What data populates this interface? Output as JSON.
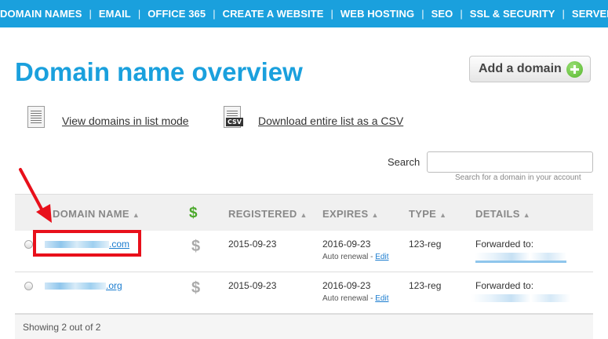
{
  "nav": {
    "items": [
      "DOMAIN NAMES",
      "EMAIL",
      "OFFICE 365",
      "CREATE A WEBSITE",
      "WEB HOSTING",
      "SEO",
      "SSL & SECURITY",
      "SERVERS"
    ],
    "separator": "|"
  },
  "page": {
    "title": "Domain name overview",
    "add_button": "Add a domain",
    "view_list_link": "View domains in list mode",
    "download_csv_link": "Download entire list as a CSV",
    "csv_icon_label": "CSV"
  },
  "search": {
    "label": "Search",
    "hint": "Search for a domain in your account"
  },
  "table": {
    "headers": {
      "domain": "DOMAIN NAME",
      "price": "$",
      "registered": "REGISTERED",
      "expires": "EXPIRES",
      "type": "TYPE",
      "details": "DETAILS"
    },
    "sort_glyph": "▲",
    "rows": [
      {
        "domain_suffix": ".com",
        "price": "$",
        "registered": "2015-09-23",
        "expires": "2016-09-23",
        "renewal": "Auto renewal - ",
        "edit": "Edit",
        "type": "123-reg",
        "details": "Forwarded to:"
      },
      {
        "domain_suffix": ".org",
        "price": "$",
        "registered": "2015-09-23",
        "expires": "2016-09-23",
        "renewal": "Auto renewal - ",
        "edit": "Edit",
        "type": "123-reg",
        "details": "Forwarded to:"
      }
    ],
    "footer": "Showing 2 out of 2"
  },
  "colors": {
    "brand_blue": "#1aa0dd",
    "annotation_red": "#e8101b",
    "add_green": "#54b52a"
  }
}
